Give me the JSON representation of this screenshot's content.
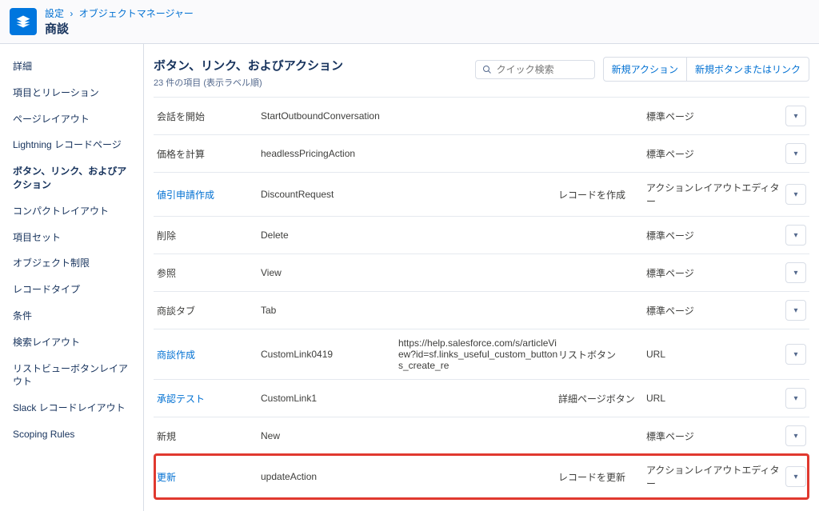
{
  "breadcrumb": {
    "setup": "設定",
    "manager": "オブジェクトマネージャー"
  },
  "page_title": "商談",
  "sidebar": {
    "items": [
      "詳細",
      "項目とリレーション",
      "ページレイアウト",
      "Lightning レコードページ",
      "ボタン、リンク、およびアクション",
      "コンパクトレイアウト",
      "項目セット",
      "オブジェクト制限",
      "レコードタイプ",
      "条件",
      "検索レイアウト",
      "リストビューボタンレイアウト",
      "Slack レコードレイアウト",
      "Scoping Rules"
    ],
    "active_index": 4
  },
  "main": {
    "title": "ボタン、リンク、およびアクション",
    "sub": "23 件の項目 (表示ラベル順)",
    "search_placeholder": "クイック検索",
    "btn_new_action": "新規アクション",
    "btn_new_button": "新規ボタンまたはリンク"
  },
  "rows": [
    {
      "label": "会話を開始",
      "link": false,
      "name": "StartOutboundConversation",
      "desc": "",
      "type": "",
      "override": "標準ページ",
      "hl": false
    },
    {
      "label": "価格を計算",
      "link": false,
      "name": "headlessPricingAction",
      "desc": "",
      "type": "",
      "override": "標準ページ",
      "hl": false
    },
    {
      "label": "値引申請作成",
      "link": true,
      "name": "DiscountRequest",
      "desc": "",
      "type": "レコードを作成",
      "override": "アクションレイアウトエディター",
      "hl": false
    },
    {
      "label": "削除",
      "link": false,
      "name": "Delete",
      "desc": "",
      "type": "",
      "override": "標準ページ",
      "hl": false
    },
    {
      "label": "参照",
      "link": false,
      "name": "View",
      "desc": "",
      "type": "",
      "override": "標準ページ",
      "hl": false
    },
    {
      "label": "商談タブ",
      "link": false,
      "name": "Tab",
      "desc": "",
      "type": "",
      "override": "標準ページ",
      "hl": false
    },
    {
      "label": "商談作成",
      "link": true,
      "name": "CustomLink0419",
      "desc": "https://help.salesforce.com/s/articleView?id=sf.links_useful_custom_buttons_create_re",
      "type": "リストボタン",
      "override": "URL",
      "hl": false
    },
    {
      "label": "承認テスト",
      "link": true,
      "name": "CustomLink1",
      "desc": "",
      "type": "詳細ページボタン",
      "override": "URL",
      "hl": false
    },
    {
      "label": "新規",
      "link": false,
      "name": "New",
      "desc": "",
      "type": "",
      "override": "標準ページ",
      "hl": false
    },
    {
      "label": "更新",
      "link": true,
      "name": "updateAction",
      "desc": "",
      "type": "レコードを更新",
      "override": "アクションレイアウトエディター",
      "hl": true
    }
  ]
}
